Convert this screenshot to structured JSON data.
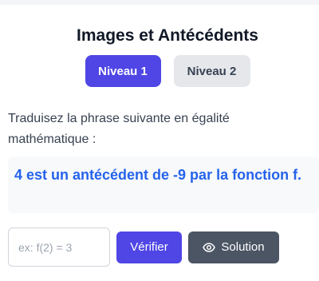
{
  "header": {
    "title": "Images et Antécédents"
  },
  "levels": [
    {
      "label": "Niveau 1",
      "active": true
    },
    {
      "label": "Niveau 2",
      "active": false
    }
  ],
  "exercise": {
    "instruction": "Traduisez la phrase suivante en égalité mathématique :",
    "statement": "4 est un antécédent de -9 par la fonction f."
  },
  "answer": {
    "value": "",
    "placeholder": "ex: f(2) = 3",
    "verify_label": "Vérifier",
    "solution_label": "Solution",
    "solution_icon": "eye-icon"
  },
  "colors": {
    "accent": "#4f46e5",
    "statement": "#2563eb",
    "inactive_button": "#e5e7eb",
    "solution_button": "#4b5563"
  }
}
